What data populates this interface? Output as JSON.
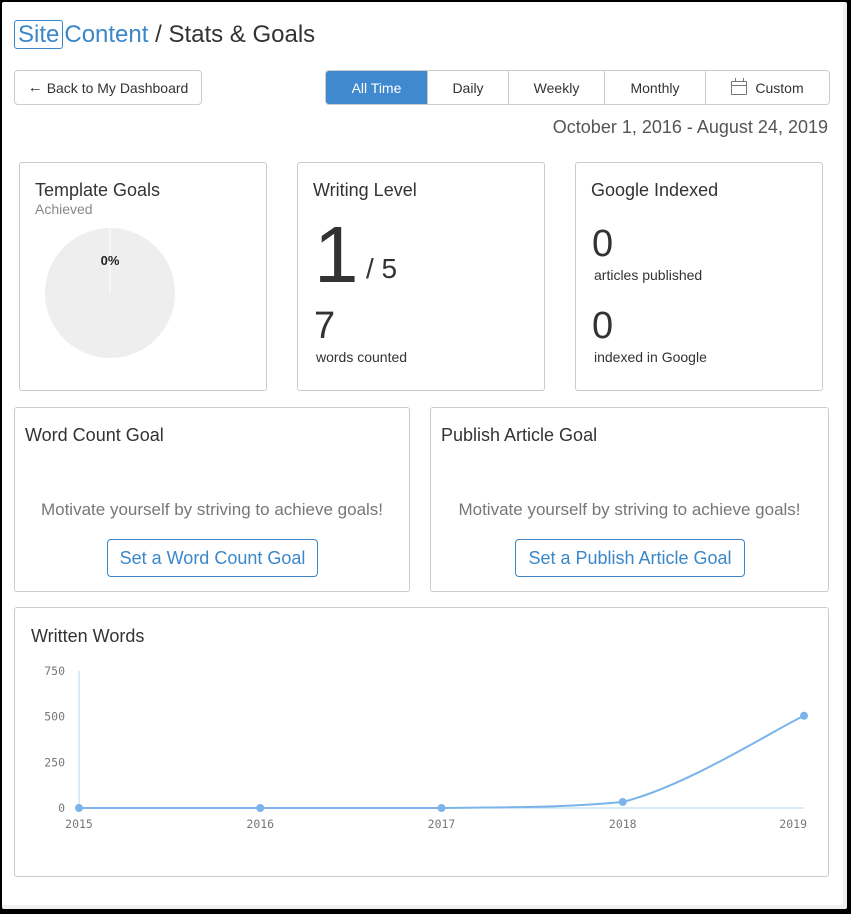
{
  "header": {
    "breadcrumb_site": "Site",
    "breadcrumb_content": "Content",
    "breadcrumb_sep": " / ",
    "page_title": "Stats & Goals"
  },
  "toolbar": {
    "back_arrow": "←",
    "back_label": "Back to My Dashboard",
    "ranges": [
      {
        "label": "All Time",
        "active": true
      },
      {
        "label": "Daily",
        "active": false
      },
      {
        "label": "Weekly",
        "active": false
      },
      {
        "label": "Monthly",
        "active": false
      },
      {
        "label": "Custom",
        "active": false,
        "icon": "calendar-icon"
      }
    ],
    "date_range": "October 1, 2016 - August 24, 2019"
  },
  "template_goals": {
    "title": "Template Goals",
    "subtitle": "Achieved",
    "percent_label": "0%",
    "achieved_fraction": 0
  },
  "writing_level": {
    "title": "Writing Level",
    "level": "1",
    "level_max": "/ 5",
    "words": "7",
    "words_label": "words counted"
  },
  "google_indexed": {
    "title": "Google Indexed",
    "articles": "0",
    "articles_label": "articles published",
    "indexed": "0",
    "indexed_label": "indexed in Google"
  },
  "word_count_goal": {
    "title": "Word Count Goal",
    "message": "Motivate yourself by striving to achieve goals!",
    "button": "Set a Word Count Goal"
  },
  "publish_goal": {
    "title": "Publish Article Goal",
    "message": "Motivate yourself by striving to achieve goals!",
    "button": "Set a Publish Article Goal"
  },
  "colors": {
    "accent": "#3a87c9",
    "active_tab": "#4089cf",
    "line": "#7ab4ea",
    "axis": "#b7d4ef",
    "pie_fill": "#eeeeee"
  },
  "chart_data": {
    "type": "line",
    "title": "Written Words",
    "xlabel": "",
    "ylabel": "",
    "x": [
      "2015",
      "2016",
      "2017",
      "2018",
      "2019"
    ],
    "series": [
      {
        "name": "Written Words",
        "values": [
          0,
          0,
          0,
          33,
          505
        ]
      }
    ],
    "yticks": [
      0,
      250,
      500,
      750
    ],
    "ylim": [
      0,
      750
    ],
    "grid": false,
    "legend": "none",
    "smooth": true
  }
}
